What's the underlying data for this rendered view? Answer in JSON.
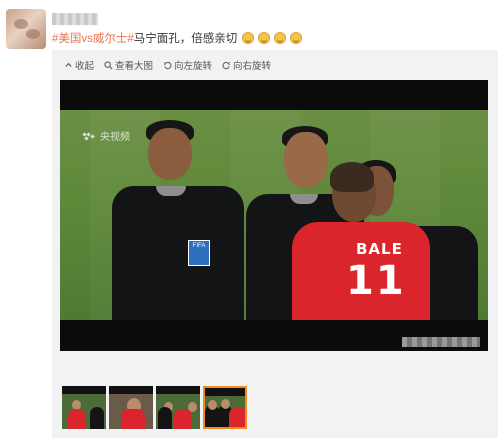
{
  "post": {
    "hashtag": "#美国vs威尔士#",
    "text": "马宁面孔，倍感亲切",
    "emoji_names": [
      "grin-emoji",
      "grin-emoji",
      "grin-emoji",
      "grin-emoji"
    ]
  },
  "toolbar": {
    "collapse": "收起",
    "view_large": "查看大图",
    "rotate_left": "向左旋转",
    "rotate_right": "向右旋转"
  },
  "photo": {
    "broadcaster": "央视频",
    "player_name": "BALE",
    "player_number": "11",
    "badge": "FIFA"
  },
  "thumbnails": {
    "count": 4,
    "selected_index": 3
  },
  "colors": {
    "hashtag": "#eb7350",
    "selected_border": "#f18b1e",
    "wales_red": "#d9252b",
    "pitch_green": "#5f8a3a"
  }
}
